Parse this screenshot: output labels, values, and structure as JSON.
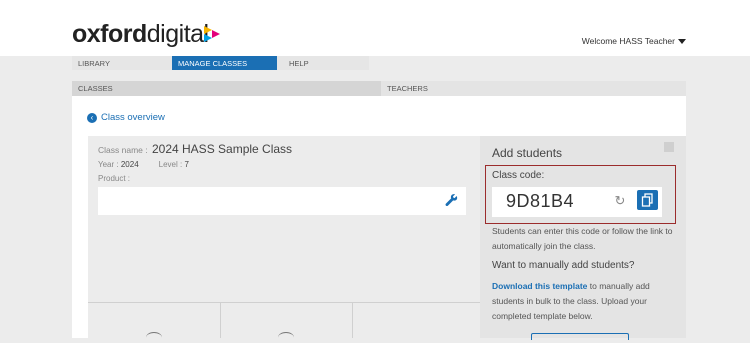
{
  "header": {
    "logo_bold": "oxford",
    "logo_light": "digital",
    "welcome_text": "Welcome HASS Teacher",
    "brand_colors": [
      "#f7b500",
      "#e4007c",
      "#00a0e3",
      "#1b6fb4"
    ]
  },
  "nav": {
    "items": [
      {
        "label": "LIBRARY",
        "active": false
      },
      {
        "label": "MANAGE CLASSES",
        "active": true
      },
      {
        "label": "HELP",
        "active": false
      }
    ]
  },
  "subtabs": {
    "items": [
      {
        "label": "CLASSES",
        "active": true
      },
      {
        "label": "TEACHERS",
        "active": false
      }
    ]
  },
  "back_link": {
    "label": "Class overview",
    "icon": "chevron-left-circle-icon"
  },
  "class_card": {
    "name_label": "Class name :",
    "name_value": "2024 HASS Sample Class",
    "year_label": "Year :",
    "year_value": "2024",
    "level_label": "Level :",
    "level_value": "7",
    "product_label": "Product :",
    "edit_icon": "wrench-icon"
  },
  "add_students": {
    "title": "Add students",
    "class_code_label": "Class code:",
    "class_code": "9D81B4",
    "refresh_icon": "refresh-icon",
    "copy_icon": "copy-icon",
    "info_text": "Students can enter this code or follow the link to automatically join the class.",
    "manual_heading": "Want to manually add students?",
    "download_link": "Download this template",
    "download_rest": " to manually add students in bulk to the class. Upload your completed template below.",
    "accent_color": "#1b6fb4",
    "highlight_color": "#9b2c2c"
  }
}
